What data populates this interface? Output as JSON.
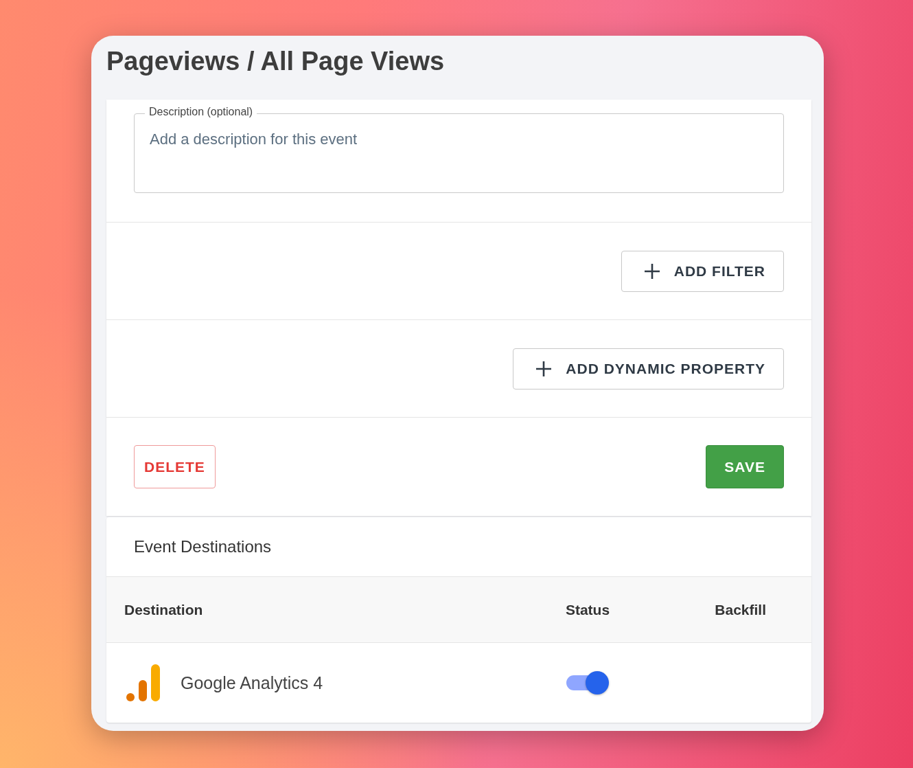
{
  "title": "Pageviews / All Page Views",
  "description_field": {
    "label": "Description (optional)",
    "placeholder": "Add a description for this event"
  },
  "add_buttons": [
    {
      "label": "ADD FILTER"
    },
    {
      "label": "ADD DYNAMIC PROPERTY"
    }
  ],
  "form_buttons": [
    {
      "kind": "delete",
      "label": "DELETE"
    },
    {
      "kind": "save",
      "label": "SAVE"
    }
  ],
  "destinations": {
    "title": "Event Destinations",
    "columns": [
      "Destination",
      "Status",
      "Backfill"
    ],
    "rows": [
      {
        "name": "Google Analytics 4",
        "on": true
      }
    ]
  }
}
